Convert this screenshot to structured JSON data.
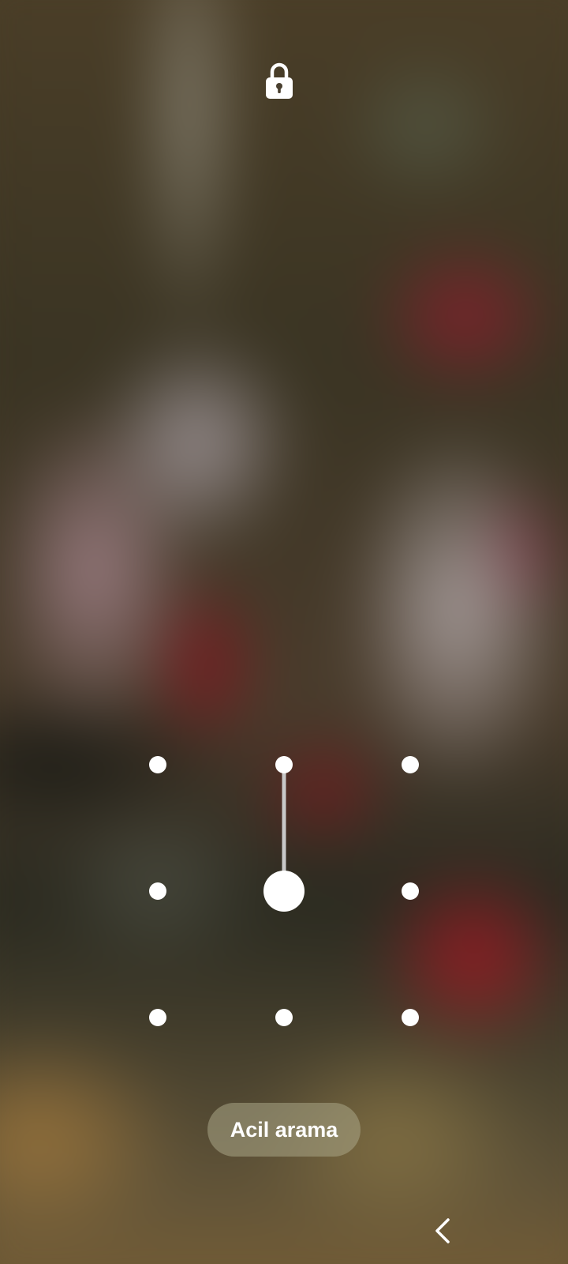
{
  "lock_screen": {
    "icon": "lock-icon",
    "pattern": {
      "rows": 3,
      "cols": 3,
      "active_dots": [
        2,
        5
      ],
      "dot_color": "#ffffff",
      "line_color": "#c8c8c8"
    },
    "emergency_call": {
      "label": "Acil arama"
    }
  },
  "navigation_bar": {
    "back_icon": "chevron-left-icon"
  }
}
